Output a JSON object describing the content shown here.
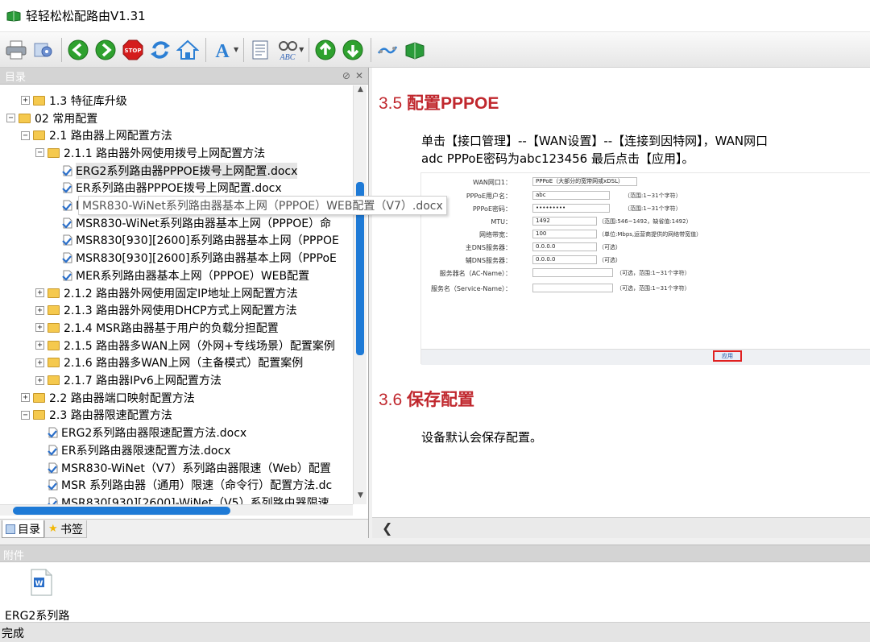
{
  "window": {
    "title": "轻轻松松配路由V1.31"
  },
  "toolbar": {
    "buttons": [
      "print-icon",
      "settings-icon",
      "back-icon",
      "forward-icon",
      "stop-icon",
      "refresh-icon",
      "home-icon",
      "font-icon",
      "notes-icon",
      "spell-check-icon",
      "up-icon",
      "down-icon",
      "link-icon",
      "book-icon"
    ],
    "colors": {
      "green": "#2fa12f",
      "stop_red": "#d41d1d",
      "blue": "#2c7fd4"
    }
  },
  "left_pane": {
    "header": "目录",
    "tree": [
      {
        "level": 1,
        "expander": "+",
        "kind": "folder",
        "label": "1.3 特征库升级"
      },
      {
        "level": 0,
        "expander": "-",
        "kind": "folder",
        "label": "02 常用配置"
      },
      {
        "level": 1,
        "expander": "-",
        "kind": "folder",
        "label": "2.1 路由器上网配置方法"
      },
      {
        "level": 2,
        "expander": "-",
        "kind": "folder",
        "label": "2.1.1 路由器外网使用拨号上网配置方法"
      },
      {
        "level": 3,
        "expander": "",
        "kind": "doc",
        "label": "ERG2系列路由器PPPOE拨号上网配置.docx",
        "selected": true
      },
      {
        "level": 3,
        "expander": "",
        "kind": "doc",
        "label": "ER系列路由器PPPOE拨号上网配置.docx"
      },
      {
        "level": 3,
        "expander": "",
        "kind": "doc",
        "label": "MSR830-WiNet系列路由器基本上网（PPPOE）WEB配置（V7）.docx"
      },
      {
        "level": 3,
        "expander": "",
        "kind": "doc",
        "label": "MSR830-WiNet系列路由器基本上网（PPPOE）命"
      },
      {
        "level": 3,
        "expander": "",
        "kind": "doc",
        "label": "MSR830[930][2600]系列路由器基本上网（PPPOE"
      },
      {
        "level": 3,
        "expander": "",
        "kind": "doc",
        "label": "MSR830[930][2600]系列路由器基本上网（PPPoE"
      },
      {
        "level": 3,
        "expander": "",
        "kind": "doc",
        "label": "MER系列路由器基本上网（PPPOE）WEB配置"
      },
      {
        "level": 2,
        "expander": "+",
        "kind": "folder",
        "label": "2.1.2 路由器外网使用固定IP地址上网配置方法"
      },
      {
        "level": 2,
        "expander": "+",
        "kind": "folder",
        "label": "2.1.3 路由器外网使用DHCP方式上网配置方法"
      },
      {
        "level": 2,
        "expander": "+",
        "kind": "folder",
        "label": "2.1.4 MSR路由器基于用户的负载分担配置"
      },
      {
        "level": 2,
        "expander": "+",
        "kind": "folder",
        "label": "2.1.5 路由器多WAN上网（外网+专线场景）配置案例"
      },
      {
        "level": 2,
        "expander": "+",
        "kind": "folder",
        "label": "2.1.6 路由器多WAN上网（主备模式）配置案例"
      },
      {
        "level": 2,
        "expander": "+",
        "kind": "folder",
        "label": "2.1.7 路由器IPv6上网配置方法"
      },
      {
        "level": 1,
        "expander": "+",
        "kind": "folder",
        "label": "2.2 路由器端口映射配置方法"
      },
      {
        "level": 1,
        "expander": "-",
        "kind": "folder",
        "label": "2.3 路由器限速配置方法"
      },
      {
        "level": 2,
        "expander": "",
        "kind": "doc",
        "label": "ERG2系列路由器限速配置方法.docx"
      },
      {
        "level": 2,
        "expander": "",
        "kind": "doc",
        "label": "ER系列路由器限速配置方法.docx"
      },
      {
        "level": 2,
        "expander": "",
        "kind": "doc",
        "label": "MSR830-WiNet（V7）系列路由器限速（Web）配置"
      },
      {
        "level": 2,
        "expander": "",
        "kind": "doc",
        "label": "MSR 系列路由器（通用）限速（命令行）配置方法.dc"
      },
      {
        "level": 2,
        "expander": "",
        "kind": "doc",
        "label": "MSR830[930][2600]-WiNet（V5）系列路由器限速"
      }
    ],
    "tooltip": "MSR830-WiNet系列路由器基本上网（PPPOE）WEB配置（V7）.docx",
    "tabs": [
      {
        "label": "目录",
        "active": true
      },
      {
        "label": "书签",
        "active": false
      }
    ]
  },
  "content": {
    "h1_num": "3.5 ",
    "h1_text": "配置PPPOE",
    "para1_line1": "单击【接口管理】--【WAN设置】--【连接到因特网】，WAN网口",
    "para1_line2": "adc PPPoE密码为abc123456 最后点击【应用】。",
    "form": {
      "fields": [
        {
          "label": "WAN网口1：",
          "value": "PPPoE（大部分的宽带网或xDSL）",
          "hint": "",
          "select": true
        },
        {
          "label": "PPPoE用户名：",
          "value": "abc",
          "hint": "（范围:1~31个字符）"
        },
        {
          "label": "PPPoE密码：",
          "value": "•••••••••",
          "hint": "（范围:1~31个字符）"
        },
        {
          "label": "MTU：",
          "value": "1492",
          "hint": "（范围:546~1492，缺省值:1492）"
        },
        {
          "label": "网络带宽：",
          "value": "100",
          "hint": "（单位:Mbps,运营商提供的网络带宽值）"
        },
        {
          "label": "主DNS服务器：",
          "value": "0.0.0.0",
          "hint": "（可选）"
        },
        {
          "label": "辅DNS服务器：",
          "value": "0.0.0.0",
          "hint": "（可选）"
        },
        {
          "label": "服务器名（AC-Name）：",
          "value": "",
          "hint": "（可选，范围:1~31个字符）"
        },
        {
          "label": "服务名（Service-Name）：",
          "value": "",
          "hint": "（可选，范围:1~31个字符）"
        }
      ],
      "apply": "应用"
    },
    "h2_num": "3.6 ",
    "h2_text": "保存配置",
    "para2": "设备默认会保存配置。"
  },
  "attachments": {
    "header": "附件",
    "file_name": "ERG2系列路"
  },
  "status": "完成"
}
